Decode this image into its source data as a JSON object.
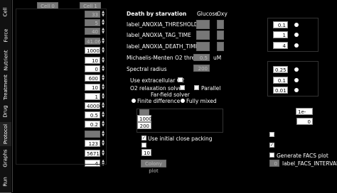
{
  "tabs": [
    "Cell",
    "Force",
    "Nutrient",
    "Treatment",
    "Drug",
    "Protocol",
    "Graphs",
    "Run"
  ],
  "top_fields": [
    "Cell 0",
    "Cell 1"
  ],
  "left_column": {
    "values": [
      "33",
      "5",
      "40",
      "41.06",
      "1000",
      "10",
      "0",
      "600",
      "10",
      "1",
      "400000",
      "0.5",
      "0.2",
      "",
      "123",
      "5671",
      "4"
    ],
    "dim": [
      true,
      true,
      true,
      true,
      false,
      false,
      false,
      false,
      false,
      false,
      false,
      false,
      false,
      true,
      false,
      false,
      false
    ]
  },
  "header": {
    "title": "Death by starvation",
    "col_glucose": "Glucose",
    "col_oxy": "Oxy"
  },
  "rows": [
    {
      "label": "label_ANOXIA_THRESHOLD"
    },
    {
      "label": "label_ANOXIA_TAG_TIME"
    },
    {
      "label": "label_ANOXIA_DEATH_TIME"
    }
  ],
  "mm_label": "Michaelis-Menten O2 thresh",
  "mm_value": "0.5",
  "mm_unit": "uM",
  "spectral_label": "Spectral radius",
  "spectral_value": "200",
  "use_extracellular": "Use extracellular O2",
  "o2_solver": "O2 relaxation solver",
  "parallel": "Parallel",
  "farfield": "Far-field solver",
  "finite_diff": "Finite difference",
  "fully_mixed": "Fully mixed",
  "ff_values": [
    "1000",
    "200"
  ],
  "use_initial": "Use initial close packing",
  "initial_value": "10",
  "colony_plot": "Colony plot",
  "right_top": [
    "0.1",
    "1",
    "4"
  ],
  "right_mid": [
    "0.25",
    "0.1",
    "0.01"
  ],
  "right_small": [
    "1e-06",
    "0"
  ],
  "generate_facs": "Generate FACS plot",
  "facs_interval_label": "label_FACS_INTERVAL",
  "facs_interval_value": "0"
}
